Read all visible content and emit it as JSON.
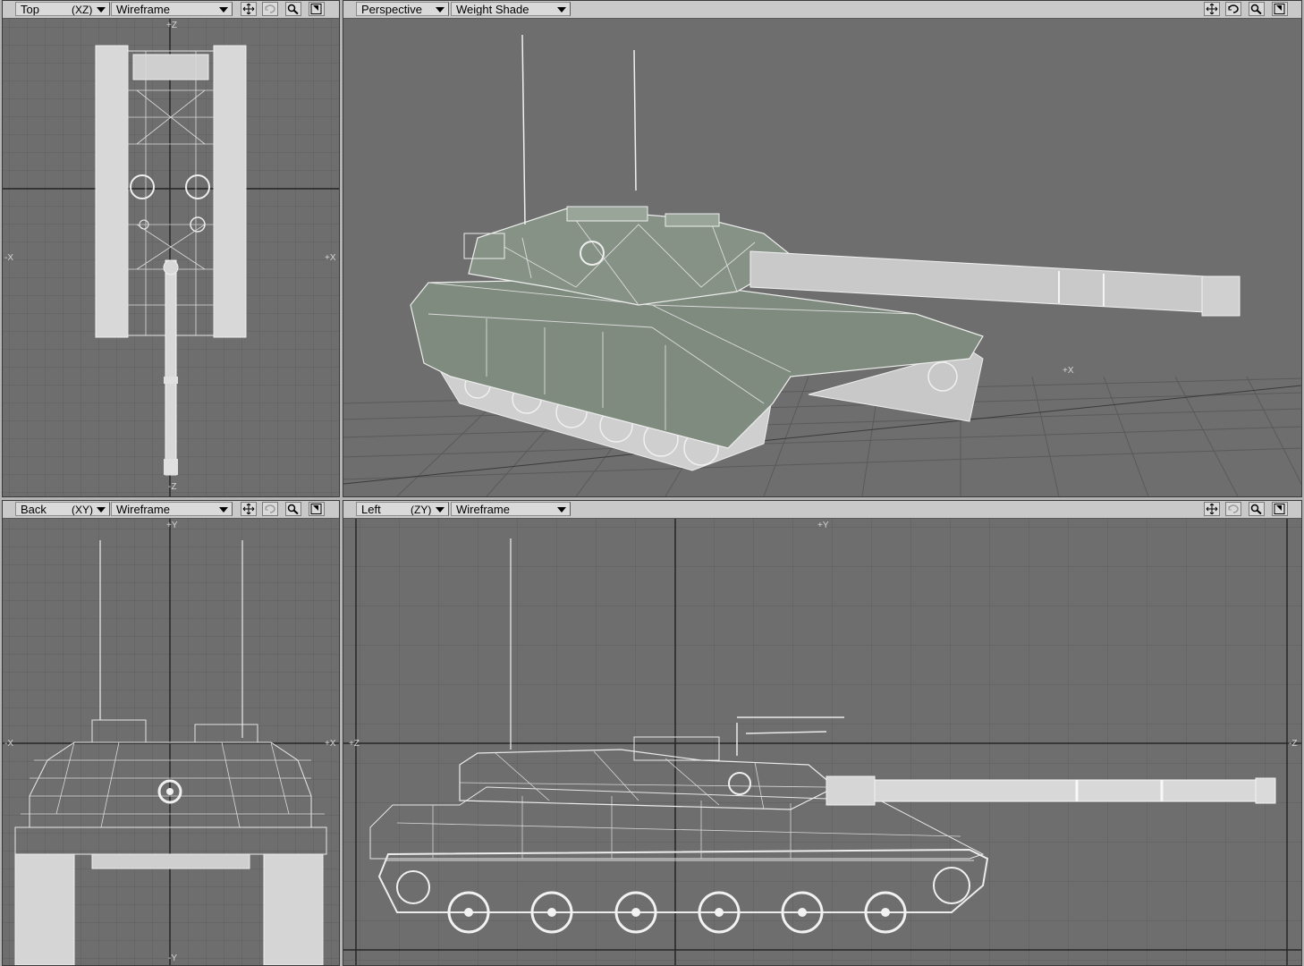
{
  "viewports": {
    "top": {
      "view": "Top",
      "axes": "(XZ)",
      "mode": "Wireframe",
      "labels": {
        "top": "+Z",
        "bottom": "-Z",
        "left": "-X",
        "right": "+X"
      }
    },
    "persp": {
      "view": "Perspective",
      "mode": "Weight Shade",
      "labels": {
        "ground": "+X"
      }
    },
    "back": {
      "view": "Back",
      "axes": "(XY)",
      "mode": "Wireframe",
      "labels": {
        "top": "+Y",
        "bottom": "-Y",
        "left": "-X",
        "right": "+X"
      }
    },
    "left": {
      "view": "Left",
      "axes": "(ZY)",
      "mode": "Wireframe",
      "labels": {
        "top": "+Y",
        "left": "+Z",
        "right": "-Z"
      }
    }
  },
  "toolbar_icons": [
    "move-icon",
    "rotate-icon",
    "zoom-icon",
    "maximize-icon"
  ],
  "colors": {
    "viewport_bg": "#6e6e6e",
    "wire": "#e8e8e8",
    "shade": "#7f8b7f",
    "grid": "#5f5f5f"
  }
}
